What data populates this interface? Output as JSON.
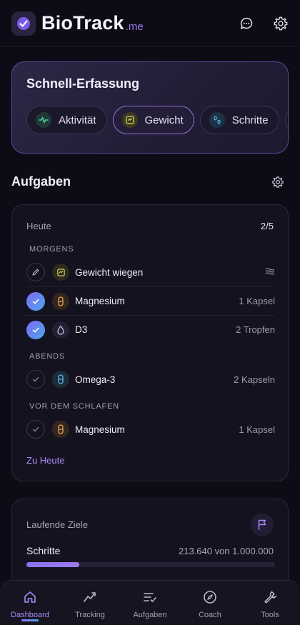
{
  "header": {
    "brand": "BioTrack",
    "brand_suffix": ".me"
  },
  "quick_entry": {
    "title": "Schnell-Erfassung",
    "chips": [
      {
        "label": "Aktivität",
        "icon": "activity-pulse-icon",
        "active": false
      },
      {
        "label": "Gewicht",
        "icon": "weight-scale-icon",
        "active": true
      },
      {
        "label": "Schritte",
        "icon": "footsteps-icon",
        "active": false
      }
    ]
  },
  "tasks": {
    "section_title": "Aufgaben",
    "day_label": "Heute",
    "progress": "2/5",
    "groups": {
      "morning": "MORGENS",
      "evening": "ABENDS",
      "bedtime": "VOR DEM SCHLAFEN"
    },
    "items": [
      {
        "name": "Gewicht wiegen",
        "qty": "",
        "done": false,
        "icon": "weight-scale-icon"
      },
      {
        "name": "Magnesium",
        "qty": "1 Kapsel",
        "done": true,
        "icon": "capsule-icon"
      },
      {
        "name": "D3",
        "qty": "2 Tropfen",
        "done": true,
        "icon": "drop-icon"
      },
      {
        "name": "Omega-3",
        "qty": "2 Kapseln",
        "done": false,
        "icon": "capsule-icon"
      },
      {
        "name": "Magnesium",
        "qty": "1 Kapsel",
        "done": false,
        "icon": "capsule-icon"
      }
    ],
    "link": "Zu Heute"
  },
  "goals": {
    "title": "Laufende Ziele",
    "items": [
      {
        "name": "Schritte",
        "value": "213.640 von 1.000.000",
        "progress": 0.2136
      }
    ]
  },
  "nav": {
    "items": [
      {
        "label": "Dashboard",
        "icon": "home-icon",
        "active": true
      },
      {
        "label": "Tracking",
        "icon": "trend-chart-icon",
        "active": false
      },
      {
        "label": "Aufgaben",
        "icon": "task-list-icon",
        "active": false
      },
      {
        "label": "Coach",
        "icon": "compass-icon",
        "active": false
      },
      {
        "label": "Tools",
        "icon": "wrench-icon",
        "active": false
      }
    ]
  },
  "colors": {
    "accent": "#a88af5",
    "background": "#0d0b15",
    "card": "#15121f"
  }
}
